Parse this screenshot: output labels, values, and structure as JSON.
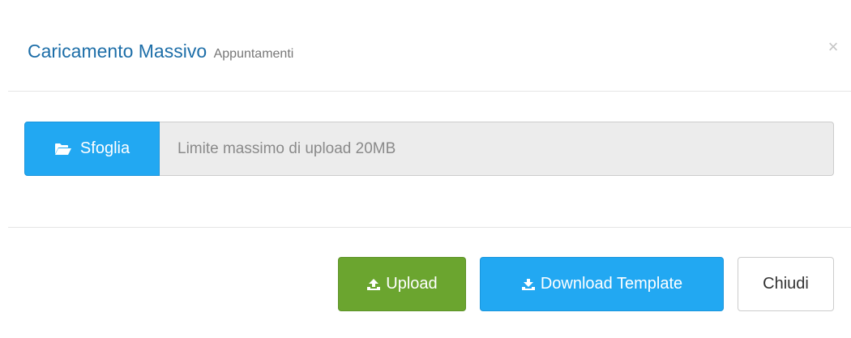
{
  "modal": {
    "title": "Caricamento Massivo",
    "subtitle": "Appuntamenti",
    "close_symbol": "×"
  },
  "upload_field": {
    "browse_label": "Sfoglia",
    "browse_icon": "folder-open-icon",
    "placeholder": "Limite massimo di upload 20MB"
  },
  "footer": {
    "upload_label": "Upload",
    "upload_icon": "upload-icon",
    "download_label": "Download Template",
    "download_icon": "download-icon",
    "close_label": "Chiudi"
  },
  "colors": {
    "title": "#1d6ea8",
    "primary": "#22a8f2",
    "success": "#6ba52f",
    "input_bg": "#ececec"
  }
}
